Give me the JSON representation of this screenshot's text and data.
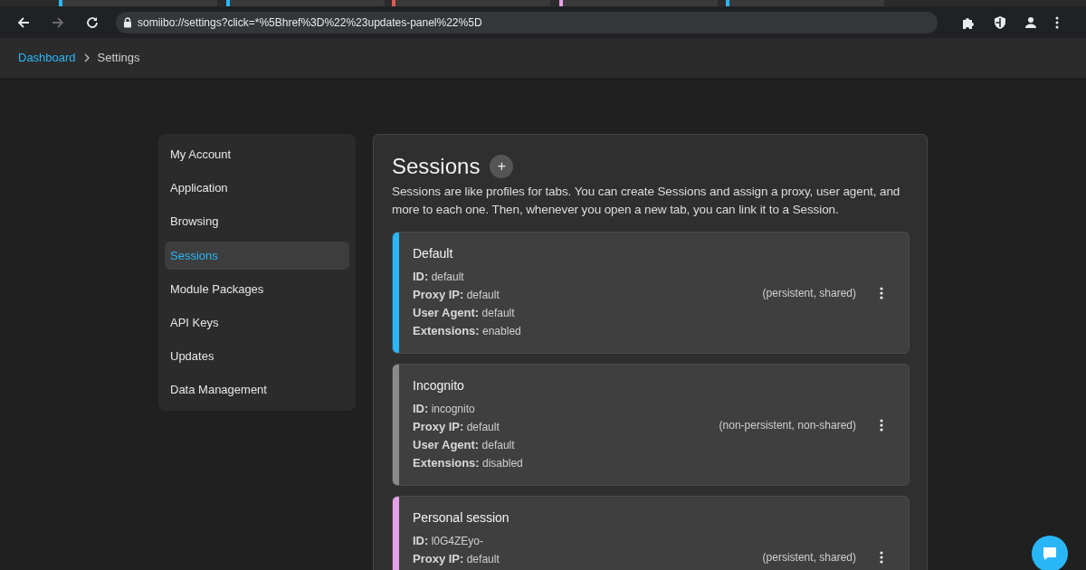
{
  "browser_tabs": [
    {
      "color": "#29b6f6"
    },
    {
      "color": "#29b6f6"
    },
    {
      "color": "#e05a5a"
    },
    {
      "color": "#e8a0e8"
    },
    {
      "color": "#29b6f6"
    }
  ],
  "address_bar": {
    "url": "somiibo://settings?click=*%5Bhref%3D%22%23updates-panel%22%5D"
  },
  "breadcrumb": [
    {
      "label": "Dashboard",
      "kind": "link"
    },
    {
      "label": "Settings",
      "kind": "current"
    }
  ],
  "sidebar": {
    "items": [
      {
        "label": "My Account",
        "selected": false
      },
      {
        "label": "Application",
        "selected": false
      },
      {
        "label": "Browsing",
        "selected": false
      },
      {
        "label": "Sessions",
        "selected": true
      },
      {
        "label": "Module Packages",
        "selected": false
      },
      {
        "label": "API Keys",
        "selected": false
      },
      {
        "label": "Updates",
        "selected": false
      },
      {
        "label": "Data Management",
        "selected": false
      }
    ]
  },
  "panel": {
    "title": "Sessions",
    "add_button": "+",
    "description": "Sessions are like profiles for tabs. You can create Sessions and assign a proxy, user agent, and more to each one. Then, whenever you open a new tab, you can link it to a Session.",
    "sessions": [
      {
        "name": "Default",
        "color": "#29b6f6",
        "fields": [
          {
            "label": "ID:",
            "value": "default"
          },
          {
            "label": "Proxy IP:",
            "value": "default"
          },
          {
            "label": "User Agent:",
            "value": "default"
          },
          {
            "label": "Extensions:",
            "value": "enabled"
          }
        ],
        "mode": "(persistent, shared)"
      },
      {
        "name": "Incognito",
        "color": "#8a8a8a",
        "fields": [
          {
            "label": "ID:",
            "value": "incognito"
          },
          {
            "label": "Proxy IP:",
            "value": "default"
          },
          {
            "label": "User Agent:",
            "value": "default"
          },
          {
            "label": "Extensions:",
            "value": "disabled"
          }
        ],
        "mode": "(non-persistent, non-shared)"
      },
      {
        "name": "Personal session",
        "color": "#e8a0e8",
        "fields": [
          {
            "label": "ID:",
            "value": "l0G4ZEyo-"
          },
          {
            "label": "Proxy IP:",
            "value": "default"
          }
        ],
        "mode": "(persistent, shared)"
      }
    ]
  }
}
